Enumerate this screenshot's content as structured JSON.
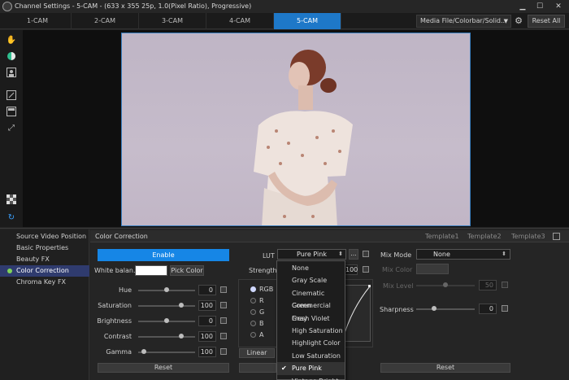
{
  "window": {
    "title": "Channel Settings - 5-CAM - (633 x 355 25p, 1.0(Pixel Ratio), Progressive)",
    "minimize": "▁",
    "maximize": "☐",
    "close": "✕"
  },
  "cam_tabs": [
    {
      "label": "1-CAM",
      "active": false
    },
    {
      "label": "2-CAM",
      "active": false
    },
    {
      "label": "3-CAM",
      "active": false
    },
    {
      "label": "4-CAM",
      "active": false
    },
    {
      "label": "5-CAM",
      "active": true
    }
  ],
  "source_select": {
    "value": "Media File/Colorbar/Solid..."
  },
  "reset_all_label": "Reset All",
  "side_menu": [
    {
      "label": "Source Video Position",
      "active": false
    },
    {
      "label": "Basic Properties",
      "active": false
    },
    {
      "label": "Beauty FX",
      "active": false
    },
    {
      "label": "Color Correction",
      "active": true
    },
    {
      "label": "Chroma Key FX",
      "active": false
    }
  ],
  "panel": {
    "title": "Color Correction",
    "templates": [
      "Template1",
      "Template2",
      "Template3"
    ],
    "enable_label": "Enable",
    "white_balance_label": "White balan...",
    "white_balance_color": "#ffffff",
    "pick_color_label": "Pick Color",
    "sliders": [
      {
        "label": "Hue",
        "value": "0",
        "fraction": 0.5
      },
      {
        "label": "Saturation",
        "value": "100",
        "fraction": 0.75
      },
      {
        "label": "Brightness",
        "value": "0",
        "fraction": 0.5
      },
      {
        "label": "Contrast",
        "value": "100",
        "fraction": 0.75
      },
      {
        "label": "Gamma",
        "value": "100",
        "fraction": 0.1
      }
    ],
    "reset_label": "Reset",
    "lut": {
      "label": "LUT",
      "value": "Pure Pink",
      "more_label": "...",
      "strength_label": "Strength",
      "strength_value": "100",
      "options": [
        "None",
        "Gray Scale",
        "Cinematic Green",
        "Commercial Gray",
        "Fresh Violet",
        "High Saturation",
        "Highlight Color",
        "Low Saturation",
        "Pure Pink",
        "Vintage Bright"
      ],
      "selected_index": 8
    },
    "channels": [
      {
        "label": "RGB",
        "selected": true
      },
      {
        "label": "R",
        "selected": false
      },
      {
        "label": "G",
        "selected": false
      },
      {
        "label": "B",
        "selected": false
      },
      {
        "label": "A",
        "selected": false
      }
    ],
    "linear_label": "Linear",
    "mix_mode": {
      "label": "Mix Mode",
      "value": "None"
    },
    "mix_color_label": "Mix Color",
    "mix_level": {
      "label": "Mix Level",
      "value": "50",
      "fraction": 0.5
    },
    "sharpness": {
      "label": "Sharpness",
      "value": "0",
      "fraction": 0.3
    },
    "right_reset_label": "Reset"
  },
  "colors": {
    "accent": "#1686e6",
    "tab_active": "#1e78c8",
    "menu_active": "#2f3b6e"
  }
}
